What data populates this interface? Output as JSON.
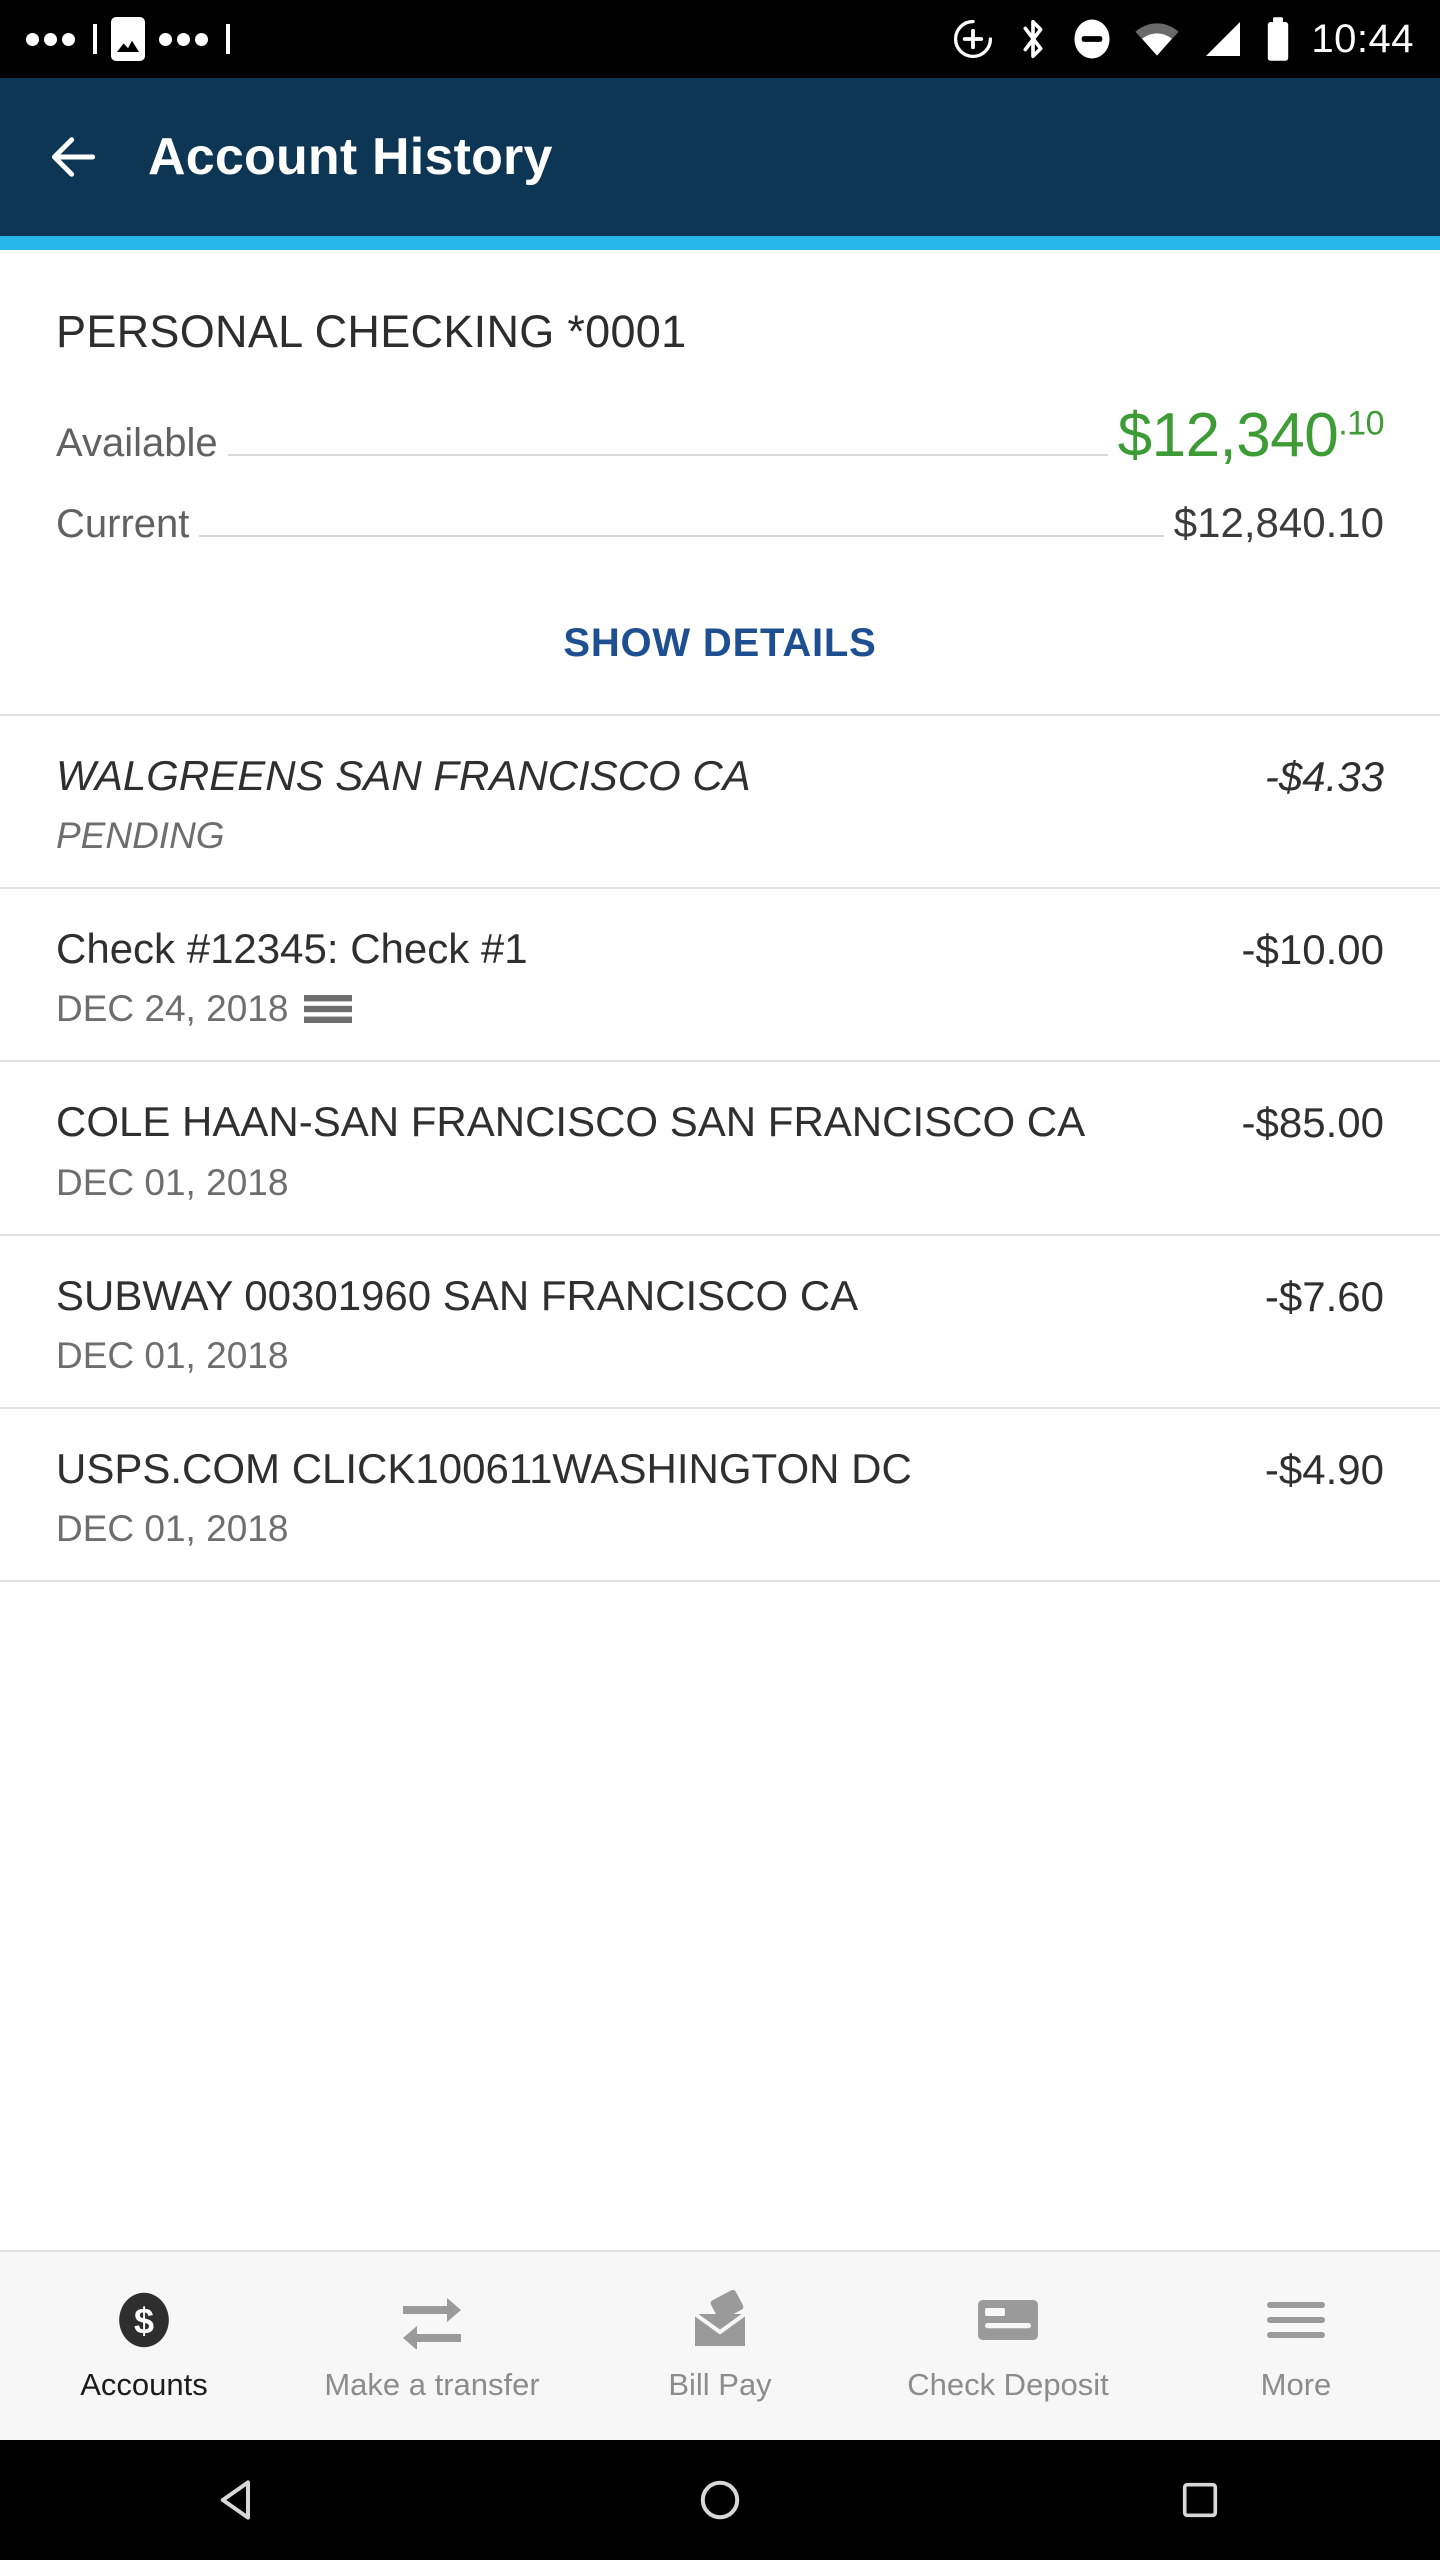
{
  "status_bar": {
    "time": "10:44",
    "icons": [
      "more-dots-icon",
      "image-icon",
      "more-dots-icon",
      "location-add-icon",
      "bluetooth-icon",
      "do-not-disturb-icon",
      "wifi-icon",
      "cellular-signal-icon",
      "battery-icon"
    ]
  },
  "app_bar": {
    "back_icon": "back-arrow-icon",
    "title": "Account History",
    "bg_color": "#0d3655",
    "accent_color": "#29b6e8"
  },
  "account": {
    "name": "PERSONAL CHECKING *0001",
    "available_label": "Available",
    "available_amount": "$12,340",
    "available_cents": ".10",
    "available_color": "#3d9c35",
    "current_label": "Current",
    "current_amount": "$12,840.10",
    "show_details_label": "SHOW DETAILS",
    "show_details_color": "#1d4f91"
  },
  "transactions": [
    {
      "description": "WALGREENS SAN FRANCISCO CA",
      "sub": "PENDING",
      "amount": "-$4.33",
      "pending": true,
      "icon": ""
    },
    {
      "description": "Check #12345: Check #1",
      "sub": "DEC 24, 2018",
      "amount": "-$10.00",
      "pending": false,
      "icon": "check-image-icon"
    },
    {
      "description": "COLE HAAN-SAN FRANCISCO SAN FRANCISCO CA",
      "sub": "DEC 01, 2018",
      "amount": "-$85.00",
      "pending": false,
      "icon": ""
    },
    {
      "description": "SUBWAY 00301960 SAN FRANCISCO CA",
      "sub": "DEC 01, 2018",
      "amount": "-$7.60",
      "pending": false,
      "icon": ""
    },
    {
      "description": "USPS.COM CLICK100611WASHINGTON DC",
      "sub": "DEC 01, 2018",
      "amount": "-$4.90",
      "pending": false,
      "icon": ""
    }
  ],
  "tab_bar": {
    "items": [
      {
        "label": "Accounts",
        "icon": "dollar-circle-icon",
        "active": true
      },
      {
        "label": "Make a transfer",
        "icon": "transfer-arrows-icon",
        "active": false
      },
      {
        "label": "Bill Pay",
        "icon": "envelope-letter-icon",
        "active": false
      },
      {
        "label": "Check Deposit",
        "icon": "check-card-icon",
        "active": false
      },
      {
        "label": "More",
        "icon": "hamburger-menu-icon",
        "active": false
      }
    ]
  },
  "nav_bar": {
    "items": [
      {
        "icon": "android-back-icon"
      },
      {
        "icon": "android-home-icon"
      },
      {
        "icon": "android-recents-icon"
      }
    ]
  }
}
